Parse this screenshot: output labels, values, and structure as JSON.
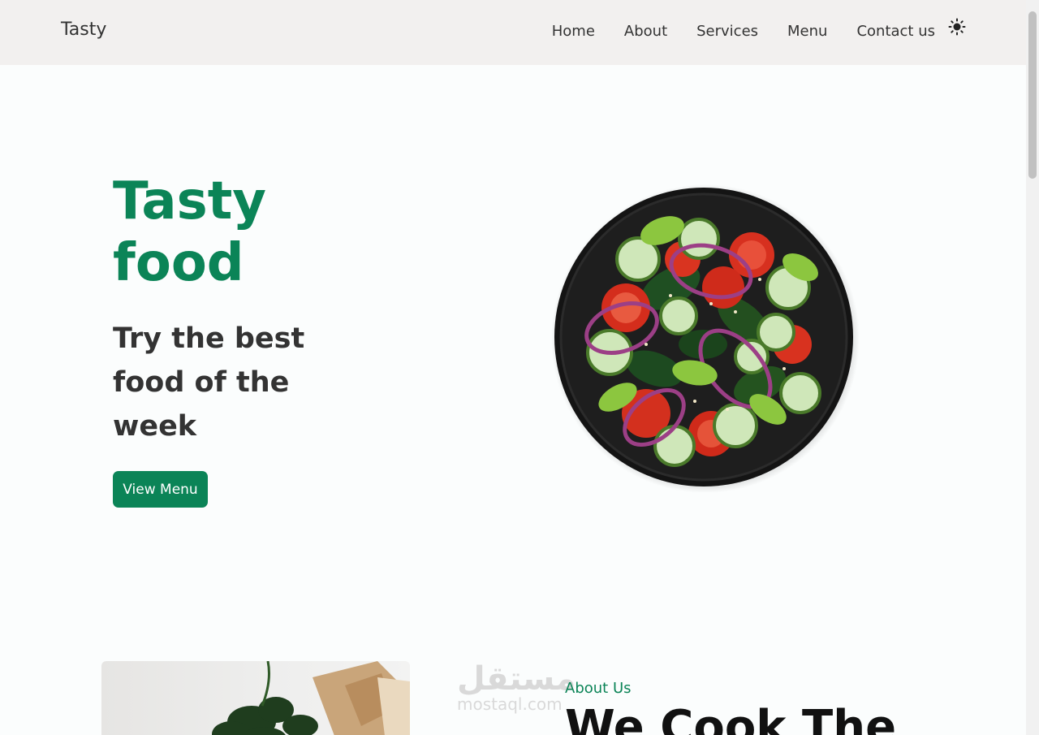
{
  "navbar": {
    "brand": "Tasty",
    "links": [
      "Home",
      "About",
      "Services",
      "Menu",
      "Contact us"
    ],
    "theme_icon": "sun-icon"
  },
  "hero": {
    "title": "Tasty food",
    "subtitle": "Try the best food of the week",
    "button_label": "View Menu",
    "image_icon": "salad-bowl-image"
  },
  "about": {
    "label": "About Us",
    "heading": "We Cook The",
    "image_icon": "herbs-cutting-board-image"
  },
  "watermark": {
    "arabic": "مستقل",
    "latin": "mostaql.com"
  },
  "colors": {
    "accent": "#0b8457",
    "navbar_bg": "#f2f0ef",
    "page_bg": "#fbfdfd",
    "text": "#333333"
  }
}
